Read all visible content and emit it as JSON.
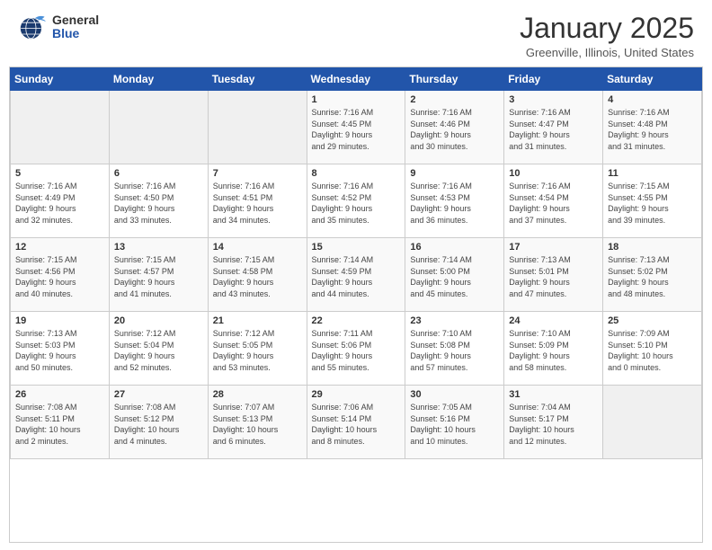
{
  "header": {
    "logo_general": "General",
    "logo_blue": "Blue",
    "month_title": "January 2025",
    "location": "Greenville, Illinois, United States"
  },
  "days_of_week": [
    "Sunday",
    "Monday",
    "Tuesday",
    "Wednesday",
    "Thursday",
    "Friday",
    "Saturday"
  ],
  "weeks": [
    [
      {
        "day": "",
        "info": ""
      },
      {
        "day": "",
        "info": ""
      },
      {
        "day": "",
        "info": ""
      },
      {
        "day": "1",
        "info": "Sunrise: 7:16 AM\nSunset: 4:45 PM\nDaylight: 9 hours\nand 29 minutes."
      },
      {
        "day": "2",
        "info": "Sunrise: 7:16 AM\nSunset: 4:46 PM\nDaylight: 9 hours\nand 30 minutes."
      },
      {
        "day": "3",
        "info": "Sunrise: 7:16 AM\nSunset: 4:47 PM\nDaylight: 9 hours\nand 31 minutes."
      },
      {
        "day": "4",
        "info": "Sunrise: 7:16 AM\nSunset: 4:48 PM\nDaylight: 9 hours\nand 31 minutes."
      }
    ],
    [
      {
        "day": "5",
        "info": "Sunrise: 7:16 AM\nSunset: 4:49 PM\nDaylight: 9 hours\nand 32 minutes."
      },
      {
        "day": "6",
        "info": "Sunrise: 7:16 AM\nSunset: 4:50 PM\nDaylight: 9 hours\nand 33 minutes."
      },
      {
        "day": "7",
        "info": "Sunrise: 7:16 AM\nSunset: 4:51 PM\nDaylight: 9 hours\nand 34 minutes."
      },
      {
        "day": "8",
        "info": "Sunrise: 7:16 AM\nSunset: 4:52 PM\nDaylight: 9 hours\nand 35 minutes."
      },
      {
        "day": "9",
        "info": "Sunrise: 7:16 AM\nSunset: 4:53 PM\nDaylight: 9 hours\nand 36 minutes."
      },
      {
        "day": "10",
        "info": "Sunrise: 7:16 AM\nSunset: 4:54 PM\nDaylight: 9 hours\nand 37 minutes."
      },
      {
        "day": "11",
        "info": "Sunrise: 7:15 AM\nSunset: 4:55 PM\nDaylight: 9 hours\nand 39 minutes."
      }
    ],
    [
      {
        "day": "12",
        "info": "Sunrise: 7:15 AM\nSunset: 4:56 PM\nDaylight: 9 hours\nand 40 minutes."
      },
      {
        "day": "13",
        "info": "Sunrise: 7:15 AM\nSunset: 4:57 PM\nDaylight: 9 hours\nand 41 minutes."
      },
      {
        "day": "14",
        "info": "Sunrise: 7:15 AM\nSunset: 4:58 PM\nDaylight: 9 hours\nand 43 minutes."
      },
      {
        "day": "15",
        "info": "Sunrise: 7:14 AM\nSunset: 4:59 PM\nDaylight: 9 hours\nand 44 minutes."
      },
      {
        "day": "16",
        "info": "Sunrise: 7:14 AM\nSunset: 5:00 PM\nDaylight: 9 hours\nand 45 minutes."
      },
      {
        "day": "17",
        "info": "Sunrise: 7:13 AM\nSunset: 5:01 PM\nDaylight: 9 hours\nand 47 minutes."
      },
      {
        "day": "18",
        "info": "Sunrise: 7:13 AM\nSunset: 5:02 PM\nDaylight: 9 hours\nand 48 minutes."
      }
    ],
    [
      {
        "day": "19",
        "info": "Sunrise: 7:13 AM\nSunset: 5:03 PM\nDaylight: 9 hours\nand 50 minutes."
      },
      {
        "day": "20",
        "info": "Sunrise: 7:12 AM\nSunset: 5:04 PM\nDaylight: 9 hours\nand 52 minutes."
      },
      {
        "day": "21",
        "info": "Sunrise: 7:12 AM\nSunset: 5:05 PM\nDaylight: 9 hours\nand 53 minutes."
      },
      {
        "day": "22",
        "info": "Sunrise: 7:11 AM\nSunset: 5:06 PM\nDaylight: 9 hours\nand 55 minutes."
      },
      {
        "day": "23",
        "info": "Sunrise: 7:10 AM\nSunset: 5:08 PM\nDaylight: 9 hours\nand 57 minutes."
      },
      {
        "day": "24",
        "info": "Sunrise: 7:10 AM\nSunset: 5:09 PM\nDaylight: 9 hours\nand 58 minutes."
      },
      {
        "day": "25",
        "info": "Sunrise: 7:09 AM\nSunset: 5:10 PM\nDaylight: 10 hours\nand 0 minutes."
      }
    ],
    [
      {
        "day": "26",
        "info": "Sunrise: 7:08 AM\nSunset: 5:11 PM\nDaylight: 10 hours\nand 2 minutes."
      },
      {
        "day": "27",
        "info": "Sunrise: 7:08 AM\nSunset: 5:12 PM\nDaylight: 10 hours\nand 4 minutes."
      },
      {
        "day": "28",
        "info": "Sunrise: 7:07 AM\nSunset: 5:13 PM\nDaylight: 10 hours\nand 6 minutes."
      },
      {
        "day": "29",
        "info": "Sunrise: 7:06 AM\nSunset: 5:14 PM\nDaylight: 10 hours\nand 8 minutes."
      },
      {
        "day": "30",
        "info": "Sunrise: 7:05 AM\nSunset: 5:16 PM\nDaylight: 10 hours\nand 10 minutes."
      },
      {
        "day": "31",
        "info": "Sunrise: 7:04 AM\nSunset: 5:17 PM\nDaylight: 10 hours\nand 12 minutes."
      },
      {
        "day": "",
        "info": ""
      }
    ]
  ]
}
